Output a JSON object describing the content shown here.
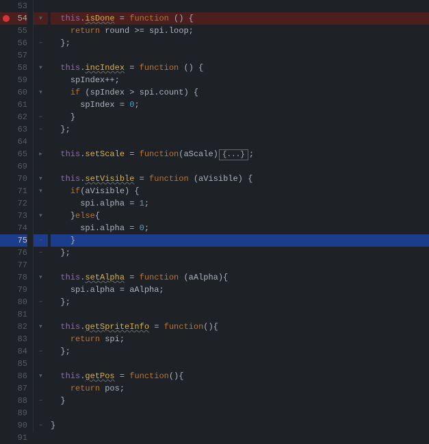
{
  "gutter": {
    "lines": [
      53,
      54,
      55,
      56,
      57,
      58,
      59,
      60,
      61,
      62,
      63,
      64,
      65,
      69,
      70,
      71,
      72,
      73,
      74,
      75,
      76,
      77,
      78,
      79,
      80,
      81,
      82,
      83,
      84,
      85,
      86,
      87,
      88,
      89,
      90,
      91
    ]
  },
  "breakpoint_line": 54,
  "selected_line": 75,
  "code": {
    "l53": {
      "tokens": []
    },
    "l54": {
      "this": "this",
      "dot": ".",
      "name": "isDone",
      "eq": " = ",
      "fn": "function",
      "paren": " () {"
    },
    "l55": {
      "ret": "return",
      "expr": " round >= spi.loop;"
    },
    "l56": {
      "close": "};"
    },
    "l57": {
      "tokens": []
    },
    "l58": {
      "this": "this",
      "dot": ".",
      "name": "incIndex",
      "eq": " = ",
      "fn": "function",
      "paren": " () {"
    },
    "l59": {
      "stmt": "spIndex++;"
    },
    "l60": {
      "if": "if",
      "cond": " (spIndex > spi.count) {"
    },
    "l61": {
      "lhs": "spIndex = ",
      "num": "0",
      "semi": ";"
    },
    "l62": {
      "close": "}"
    },
    "l63": {
      "close": "};"
    },
    "l64": {
      "tokens": []
    },
    "l65": {
      "this": "this",
      "dot": ".",
      "name": "setScale",
      "eq": " = ",
      "fn": "function",
      "paren_open": "(",
      "param": "aScale",
      "paren_close": ")",
      "folded": "{...}",
      "semi": ";"
    },
    "l69": {
      "tokens": []
    },
    "l70": {
      "this": "this",
      "dot": ".",
      "name": "setVisible",
      "eq": " = ",
      "fn": "function",
      "paren": " (aVisible) {"
    },
    "l71": {
      "if": "if",
      "paren_open": "(",
      "param": "aVisible",
      "paren_close": ") {"
    },
    "l72": {
      "lhs": "spi.alpha = ",
      "num": "1",
      "semi": ";"
    },
    "l73": {
      "close": "}",
      "else": "else",
      "open": "{"
    },
    "l74": {
      "lhs": "spi.alpha = ",
      "num": "0",
      "semi": ";"
    },
    "l75": {
      "close": "}"
    },
    "l76": {
      "close": "};"
    },
    "l77": {
      "tokens": []
    },
    "l78": {
      "this": "this",
      "dot": ".",
      "name": "setAlpha",
      "eq": " = ",
      "fn": "function",
      "paren": " (aAlpha){"
    },
    "l79": {
      "lhs": "spi.alpha = aAlpha;"
    },
    "l80": {
      "close": "};"
    },
    "l81": {
      "tokens": []
    },
    "l82": {
      "this": "this",
      "dot": ".",
      "name": "getSpriteInfo",
      "eq": " = ",
      "fn": "function",
      "paren": "(){"
    },
    "l83": {
      "ret": "return",
      "expr": " spi;"
    },
    "l84": {
      "close": "};"
    },
    "l85": {
      "tokens": []
    },
    "l86": {
      "this": "this",
      "dot": ".",
      "name": "getPos",
      "eq": " = ",
      "fn": "function",
      "paren": "(){"
    },
    "l87": {
      "ret": "return",
      "expr": " pos;"
    },
    "l88": {
      "close": "}"
    },
    "l89": {
      "tokens": []
    },
    "l90": {
      "close": "}"
    },
    "l91": {
      "tokens": []
    }
  },
  "fold_markers": {
    "down": "▾",
    "dash": "−",
    "up": "⌃",
    "right": "▸"
  }
}
